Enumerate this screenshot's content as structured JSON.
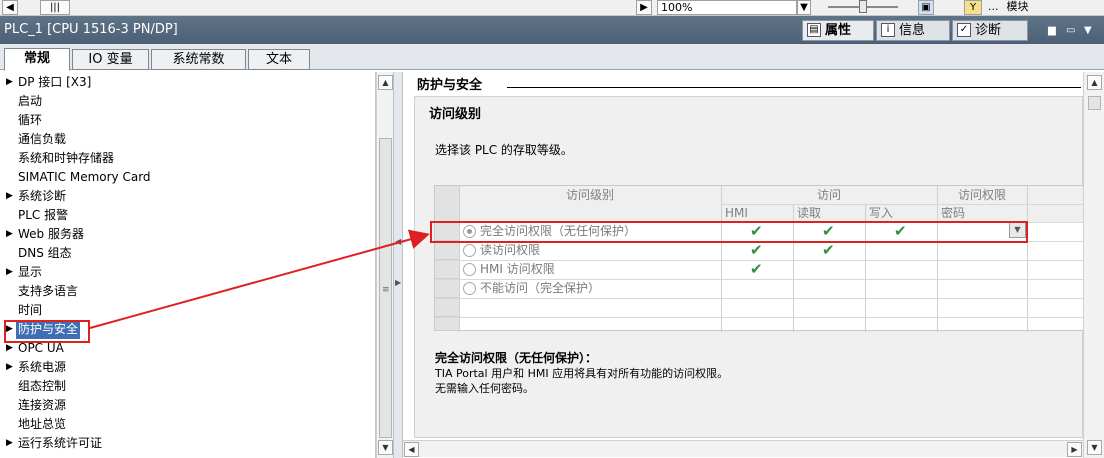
{
  "toolbar": {
    "zoom_value": "100%",
    "top_right_label": "模块",
    "top_right_dots": "..."
  },
  "title_bar": {
    "title": "PLC_1 [CPU 1516-3 PN/DP]",
    "tabs": [
      {
        "label": "属性",
        "icon": "properties-icon"
      },
      {
        "label": "信息",
        "icon": "info-icon"
      },
      {
        "label": "诊断",
        "icon": "diagnostics-icon"
      }
    ]
  },
  "main_tabs": [
    "常规",
    "IO 变量",
    "系统常数",
    "文本"
  ],
  "nav": {
    "items": [
      {
        "label": "DP 接口 [X3]",
        "expandable": true
      },
      {
        "label": "启动",
        "expandable": false
      },
      {
        "label": "循环",
        "expandable": false
      },
      {
        "label": "通信负载",
        "expandable": false
      },
      {
        "label": "系统和时钟存储器",
        "expandable": false
      },
      {
        "label": "SIMATIC Memory Card",
        "expandable": false
      },
      {
        "label": "系统诊断",
        "expandable": true
      },
      {
        "label": "PLC 报警",
        "expandable": false
      },
      {
        "label": "Web 服务器",
        "expandable": true
      },
      {
        "label": "DNS 组态",
        "expandable": false
      },
      {
        "label": "显示",
        "expandable": true
      },
      {
        "label": "支持多语言",
        "expandable": false
      },
      {
        "label": "时间",
        "expandable": false
      },
      {
        "label": "防护与安全",
        "expandable": true,
        "selected": true
      },
      {
        "label": "OPC UA",
        "expandable": true
      },
      {
        "label": "系统电源",
        "expandable": true
      },
      {
        "label": "组态控制",
        "expandable": false
      },
      {
        "label": "连接资源",
        "expandable": false
      },
      {
        "label": "地址总览",
        "expandable": false
      },
      {
        "label": "运行系统许可证",
        "expandable": true
      }
    ]
  },
  "content": {
    "section_title": "防护与安全",
    "panel_title": "访问级别",
    "description": "选择该 PLC 的存取等级。",
    "grid": {
      "header_groups": [
        "访问级别",
        "访问",
        "访问权限"
      ],
      "sub_headers": [
        "HMI",
        "读取",
        "写入",
        "密码"
      ],
      "rows": [
        {
          "label": "完全访问权限（无任何保护）",
          "checked": true,
          "hmi": true,
          "read": true,
          "write": true
        },
        {
          "label": "读访问权限",
          "checked": false,
          "hmi": true,
          "read": true,
          "write": false
        },
        {
          "label": "HMI 访问权限",
          "checked": false,
          "hmi": true,
          "read": false,
          "write": false
        },
        {
          "label": "不能访问（完全保护）",
          "checked": false,
          "hmi": false,
          "read": false,
          "write": false
        }
      ]
    },
    "info": {
      "title": "完全访问权限（无任何保护）：",
      "lines": [
        "TIA Portal 用户和 HMI 应用将具有对所有功能的访问权限。",
        "无需输入任何密码。"
      ]
    }
  },
  "colors": {
    "annotation_red": "#e02020",
    "check_green": "#2f8f3a",
    "title_bar": "#4b6075",
    "nav_selection": "#3e6fb5"
  },
  "icons": {
    "checkmark": "✔"
  }
}
